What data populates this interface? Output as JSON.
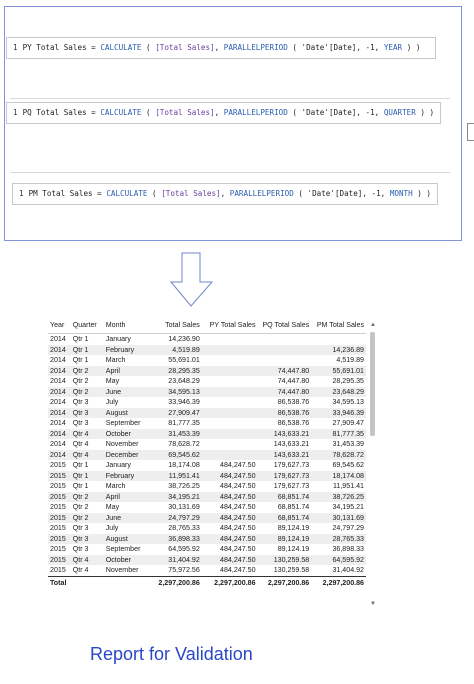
{
  "formulas": {
    "py": {
      "line_no": "1",
      "name_part": "PY Total Sales = ",
      "fn1": "CALCULATE",
      "paren_open": " ( ",
      "measure": "[Total Sales]",
      "sep": ", ",
      "fn2": "PARALLELPERIOD",
      "args_open": " ( ",
      "column": "'Date'[Date]",
      "offset": ", -1, ",
      "interval": "YEAR",
      "close": " ) )"
    },
    "pq": {
      "line_no": "1",
      "name_part": "PQ Total Sales = ",
      "fn1": "CALCULATE",
      "paren_open": " ( ",
      "measure": "[Total Sales]",
      "sep": ", ",
      "fn2": "PARALLELPERIOD",
      "args_open": " ( ",
      "column": "'Date'[Date]",
      "offset": ", -1, ",
      "interval": "QUARTER",
      "close": " ) )"
    },
    "pm": {
      "line_no": "1",
      "name_part": "PM Total Sales = ",
      "fn1": "CALCULATE",
      "paren_open": " ( ",
      "measure": "[Total Sales]",
      "sep": ", ",
      "fn2": "PARALLELPERIOD",
      "args_open": " ( ",
      "column": "'Date'[Date]",
      "offset": ", -1, ",
      "interval": "MONTH",
      "close": " ) )"
    }
  },
  "colors": {
    "keyword": "#2a5db0",
    "measure": "#6b3fa0",
    "frame_border": "#7f95d8",
    "caption": "#2947c7"
  },
  "table": {
    "headers": [
      "Year",
      "Quarter",
      "Month",
      "Total Sales",
      "PY Total Sales",
      "PQ Total Sales",
      "PM Total Sales"
    ],
    "rows": [
      [
        "2014",
        "Qtr 1",
        "January",
        "14,236.90",
        "",
        "",
        ""
      ],
      [
        "2014",
        "Qtr 1",
        "February",
        "4,519.89",
        "",
        "",
        "14,236.89"
      ],
      [
        "2014",
        "Qtr 1",
        "March",
        "55,691.01",
        "",
        "",
        "4,519.89"
      ],
      [
        "2014",
        "Qtr 2",
        "April",
        "28,295.35",
        "",
        "74,447.80",
        "55,691.01"
      ],
      [
        "2014",
        "Qtr 2",
        "May",
        "23,648.29",
        "",
        "74,447.80",
        "28,295.35"
      ],
      [
        "2014",
        "Qtr 2",
        "June",
        "34,595.13",
        "",
        "74,447.80",
        "23,648.29"
      ],
      [
        "2014",
        "Qtr 3",
        "July",
        "33,946.39",
        "",
        "86,538.76",
        "34,595.13"
      ],
      [
        "2014",
        "Qtr 3",
        "August",
        "27,909.47",
        "",
        "86,538.76",
        "33,946.39"
      ],
      [
        "2014",
        "Qtr 3",
        "September",
        "81,777.35",
        "",
        "86,538.76",
        "27,909.47"
      ],
      [
        "2014",
        "Qtr 4",
        "October",
        "31,453.39",
        "",
        "143,633.21",
        "81,777.35"
      ],
      [
        "2014",
        "Qtr 4",
        "November",
        "78,628.72",
        "",
        "143,633.21",
        "31,453.39"
      ],
      [
        "2014",
        "Qtr 4",
        "December",
        "69,545.62",
        "",
        "143,633.21",
        "78,628.72"
      ],
      [
        "2015",
        "Qtr 1",
        "January",
        "18,174.08",
        "484,247.50",
        "179,627.73",
        "69,545.62"
      ],
      [
        "2015",
        "Qtr 1",
        "February",
        "11,951.41",
        "484,247.50",
        "179,627.73",
        "18,174.08"
      ],
      [
        "2015",
        "Qtr 1",
        "March",
        "38,726.25",
        "484,247.50",
        "179,627.73",
        "11,951.41"
      ],
      [
        "2015",
        "Qtr 2",
        "April",
        "34,195.21",
        "484,247.50",
        "68,851.74",
        "38,726.25"
      ],
      [
        "2015",
        "Qtr 2",
        "May",
        "30,131.69",
        "484,247.50",
        "68,851.74",
        "34,195.21"
      ],
      [
        "2015",
        "Qtr 2",
        "June",
        "24,797.29",
        "484,247.50",
        "68,851.74",
        "30,131.69"
      ],
      [
        "2015",
        "Qtr 3",
        "July",
        "28,765.33",
        "484,247.50",
        "89,124.19",
        "24,797.29"
      ],
      [
        "2015",
        "Qtr 3",
        "August",
        "36,898.33",
        "484,247.50",
        "89,124.19",
        "28,765.33"
      ],
      [
        "2015",
        "Qtr 3",
        "September",
        "64,595.92",
        "484,247.50",
        "89,124.19",
        "36,898.33"
      ],
      [
        "2015",
        "Qtr 4",
        "October",
        "31,404.92",
        "484,247.50",
        "130,259.58",
        "64,595.92"
      ],
      [
        "2015",
        "Qtr 4",
        "November",
        "75,972.56",
        "484,247.50",
        "130,259.58",
        "31,404.92"
      ]
    ],
    "total": [
      "Total",
      "",
      "",
      "2,297,200.86",
      "2,297,200.86",
      "2,297,200.86",
      "2,297,200.86"
    ]
  },
  "caption": "Report for Validation"
}
